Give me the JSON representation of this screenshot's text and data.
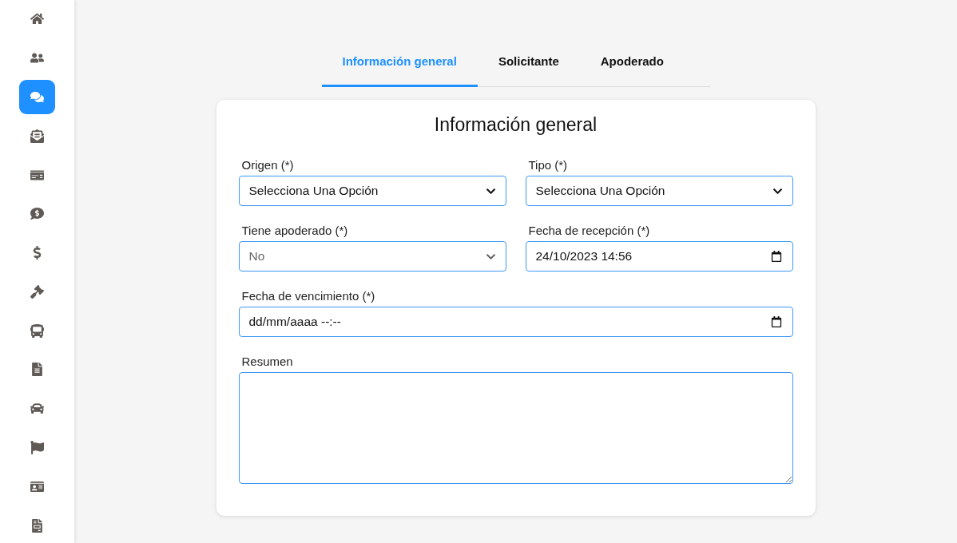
{
  "sidebar": {
    "items": [
      {
        "selected": false
      },
      {
        "selected": false
      },
      {
        "selected": true
      },
      {
        "selected": false
      },
      {
        "selected": false
      },
      {
        "selected": false
      },
      {
        "selected": false
      },
      {
        "selected": false
      },
      {
        "selected": false
      },
      {
        "selected": false
      },
      {
        "selected": false
      },
      {
        "selected": false
      },
      {
        "selected": false
      },
      {
        "selected": false
      }
    ]
  },
  "tabs": [
    {
      "label": "Información general",
      "selected": true
    },
    {
      "label": "Solicitante",
      "selected": false
    },
    {
      "label": "Apoderado",
      "selected": false
    }
  ],
  "form": {
    "title": "Información general",
    "fields": [
      {
        "kind": "select",
        "label": "Origen (*)",
        "value": "Selecciona Una Opción",
        "dimmed": false,
        "wide": false
      },
      {
        "kind": "select",
        "label": "Tipo (*)",
        "value": "Selecciona Una Opción",
        "dimmed": false,
        "wide": false
      },
      {
        "kind": "select",
        "label": "Tiene apoderado (*)",
        "value": "No",
        "dimmed": true,
        "wide": false
      },
      {
        "kind": "date",
        "label": "Fecha de recepción (*)",
        "value": "24/10/2023 14:56",
        "wide": false
      },
      {
        "kind": "date",
        "label": "Fecha de vencimiento (*)",
        "placeholder": "dd/mm/aaaa --:--",
        "wide": true
      },
      {
        "kind": "textarea",
        "label": "Resumen",
        "wide": true
      }
    ]
  }
}
